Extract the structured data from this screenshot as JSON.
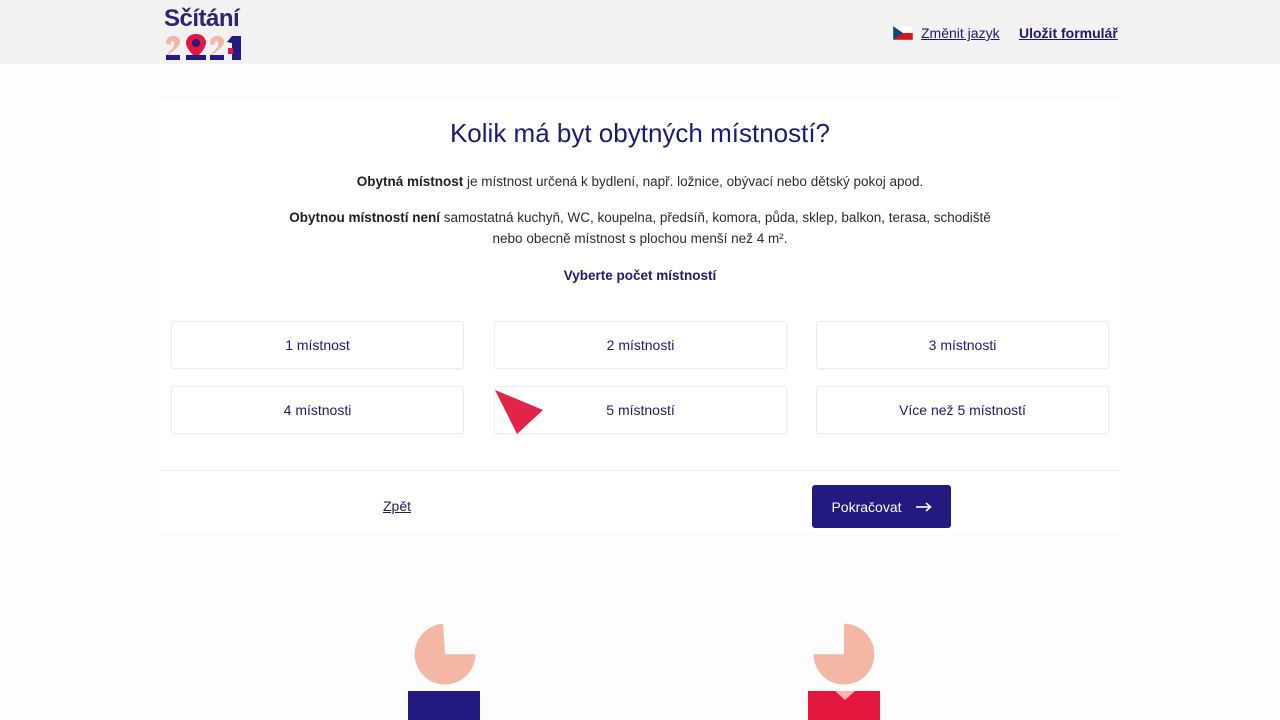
{
  "header": {
    "logo_text": "Sčítání",
    "change_language_label": "Změnit jazyk",
    "save_form_label": "Uložit formulář"
  },
  "question": {
    "title": "Kolik má byt obytných místností?",
    "definition_bold": "Obytná místnost",
    "definition_rest": " je místnost určená k bydlení, např. ložnice, obývací nebo dětský pokoj apod.",
    "exclusion_bold": "Obytnou místností není",
    "exclusion_rest": " samostatná kuchyň, WC, koupelna, předsíň, komora, půda, sklep, balkon, terasa, schodiště nebo obecně místnost s plochou menší než 4 m².",
    "instruction": "Vyberte počet místností"
  },
  "options": [
    {
      "label": "1 místnost"
    },
    {
      "label": "2 místnosti"
    },
    {
      "label": "3 místnosti"
    },
    {
      "label": "4 místnosti"
    },
    {
      "label": "5 místností"
    },
    {
      "label": "Více než 5 místností"
    }
  ],
  "navigation": {
    "back_label": "Zpět",
    "continue_label": "Pokračovat"
  },
  "colors": {
    "primary": "#221a80",
    "accent_red": "#e3173e",
    "figure_skin": "#f4b7a6",
    "text_dark": "#1e1a6e"
  },
  "icons": {
    "flag": "czech-flag-icon",
    "continue": "arrow-right-icon",
    "cursor": "pointer-arrow-icon"
  }
}
